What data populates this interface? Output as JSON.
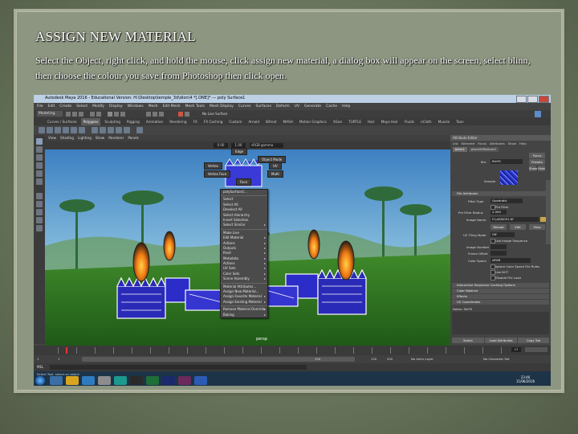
{
  "slide": {
    "title": "ASSIGN NEW MATERIAL",
    "body": "Select the Object, right click, and hold the mouse, click assign new material, a dialog box will appear on the screen, select blinn, then choose the colour you save from Photoshop then click open."
  },
  "maya": {
    "window_title": "Autodesk Maya 2016 - Educational Version: H:\\Desktop\\temple_3d\\dion\\4 *[.ONE]* --- poly Surface1",
    "menus": [
      "File",
      "Edit",
      "Create",
      "Select",
      "Modify",
      "Display",
      "Windows",
      "Mesh",
      "Edit Mesh",
      "Mesh Tools",
      "Mesh Display",
      "Curves",
      "Surfaces",
      "Deform",
      "UV",
      "Generate",
      "Cache",
      "Help"
    ],
    "mode_menu": "Modeling",
    "live_surface": "No Live Surface",
    "shelf_tabs": [
      "Curves / Surfaces",
      "Polygons",
      "Sculpting",
      "Rigging",
      "Animation",
      "Rendering",
      "FX",
      "FX Caching",
      "Custom",
      "Arnold",
      "Bifrost",
      "MASH",
      "Motion Graphics",
      "XGen",
      "TURTLE",
      "Hair",
      "Maya Hair",
      "Fluids",
      "nCloth",
      "Muscle",
      "Toon"
    ],
    "active_shelf_tab": "Polygons",
    "viewport_menu": [
      "View",
      "Shading",
      "Lighting",
      "Show",
      "Renderer",
      "Panels"
    ],
    "viewport_fields": {
      "frame_a": "0.00",
      "frame_b": "1.00",
      "color_space": "sRGB gamma"
    },
    "marking_menu": {
      "edge": "Edge",
      "object_mode": "Object Mode",
      "vertex": "Vertex",
      "uv": "UV",
      "vertex_face": "Vertex Face",
      "multi": "Multi",
      "face": "Face"
    },
    "context_menu": [
      "polySurface1...",
      "Select",
      "Select All",
      "Deselect All",
      "Select Hierarchy",
      "Invert Selection",
      "Select Similar",
      "Make Live",
      "Edit Material",
      "Actions",
      "Outputs",
      "Paint",
      "Metadata",
      "Actions",
      "UV Sets",
      "Color Sets",
      "Scene Assembly",
      "Material Attributes...",
      "Assign New Material...",
      "Assign Favorite Material",
      "Assign Existing Material",
      "Remove Material Override",
      "Baking"
    ],
    "submenu_flags": [
      false,
      false,
      false,
      false,
      false,
      false,
      true,
      false,
      true,
      true,
      true,
      true,
      true,
      true,
      true,
      true,
      true,
      false,
      false,
      true,
      true,
      true,
      true
    ],
    "attribute_editor": {
      "title": "Attribute Editor",
      "menu": [
        "List",
        "Selected",
        "Focus",
        "Attributes",
        "Show",
        "Help"
      ],
      "tabs": [
        "blinn1",
        "place2dTexture1"
      ],
      "file_label": "file:",
      "file_value": "file39",
      "focus_btn": "Focus",
      "presets_btn": "Presets",
      "show_btn": "Show",
      "hide_btn": "Hide",
      "sample_label": "Sample",
      "section_file_attributes": "File Attributes",
      "filter_type_label": "Filter Type",
      "filter_type_value": "Quadratic",
      "pre_filter_label": "Pre Filter",
      "pre_filter_radius_label": "Pre Filter Radius",
      "pre_filter_radius_value": "2.000",
      "image_name_label": "Image Name",
      "image_name_value": "F:\\u4\\f0001.tif",
      "reload_btn": "Reload",
      "edit_btn": "Edit",
      "view_btn": "View",
      "uv_tiling_label": "UV Tiling Mode",
      "uv_tiling_value": "Off",
      "use_image_seq": "Use Image Sequence",
      "image_number_label": "Image Number",
      "frame_offset_label": "Frame Offset",
      "color_space_label": "Color Space",
      "color_space_value": "sRGB",
      "ignore_cs_rules": "Ignore Color Space File Rules",
      "use_bot": "Use BOT",
      "disable_file_load": "Disable File Load",
      "sections": [
        "Interactive Sequence Caching Options",
        "Color Balance",
        "Effects",
        "UV Coordinates"
      ],
      "notes_label": "Notes: file39",
      "select_btn": "Select",
      "load_attr_btn": "Load Attributes",
      "copy_tab_btn": "Copy Tab"
    },
    "timeline": {
      "start": "1",
      "end": "120",
      "current": "1",
      "range_start": "1",
      "range_end": "120",
      "range_end2": "200",
      "current_frame": "17"
    },
    "mel_label": "MEL",
    "no_anim_layer": "No Anim Layer",
    "no_char_set": "No Character Set",
    "help_line": "Select Tool: select an object",
    "clock": {
      "time": "23:46",
      "date": "11/06/2016"
    }
  }
}
